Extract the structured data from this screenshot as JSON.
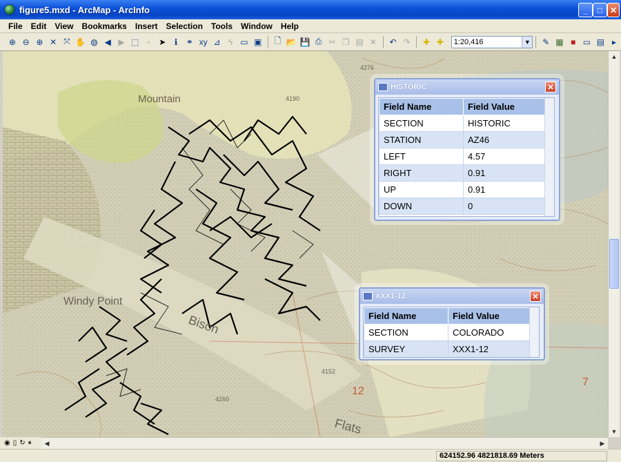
{
  "window": {
    "title": "figure5.mxd - ArcMap - ArcInfo",
    "minimize_glyph": "_",
    "maximize_glyph": "□",
    "close_glyph": "✕"
  },
  "menu": [
    "File",
    "Edit",
    "View",
    "Bookmarks",
    "Insert",
    "Selection",
    "Tools",
    "Window",
    "Help"
  ],
  "toolbar": {
    "scale_value": "1:20,416"
  },
  "map": {
    "labels": [
      {
        "text": "Mountain"
      },
      {
        "text": "4276"
      },
      {
        "text": "4190"
      },
      {
        "text": "Windy Point"
      },
      {
        "text": "Bison"
      },
      {
        "text": "4152"
      },
      {
        "text": "4260"
      },
      {
        "text": "12"
      },
      {
        "text": "Flats"
      },
      {
        "text": "7"
      }
    ]
  },
  "popups": [
    {
      "title": "HISTORIC",
      "headers": [
        "Field Name",
        "Field Value"
      ],
      "rows": [
        [
          "SECTION",
          "HISTORIC"
        ],
        [
          "STATION",
          "AZ46"
        ],
        [
          "LEFT",
          "4.57"
        ],
        [
          "RIGHT",
          "0.91"
        ],
        [
          "UP",
          "0.91"
        ],
        [
          "DOWN",
          "0"
        ]
      ]
    },
    {
      "title": "XXX1-12",
      "headers": [
        "Field Name",
        "Field Value"
      ],
      "rows": [
        [
          "SECTION",
          "COLORADO"
        ],
        [
          "SURVEY",
          "XXX1-12"
        ]
      ]
    }
  ],
  "status": {
    "coordinates": "624152.96  4821818.69 Meters"
  }
}
